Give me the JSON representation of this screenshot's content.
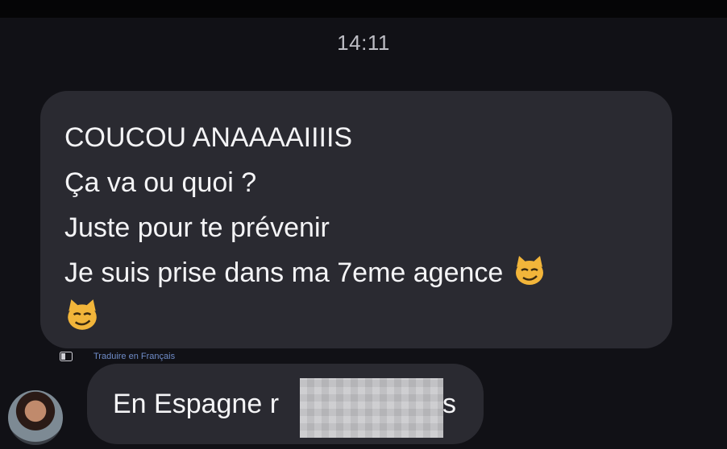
{
  "conversation": {
    "timestamp": "14:11",
    "message1": {
      "lines": [
        "COUCOU ANAAAAIIIIS",
        "Ça va ou quoi ?",
        "Juste pour te prévenir",
        "Je suis prise dans ma 7eme agence"
      ],
      "emoji": "smirking-cat-emoji"
    },
    "translate_label": "Traduire en Français",
    "message2": {
      "text_visible_start": "En Espagne r",
      "text_visible_end": "s"
    }
  },
  "colors": {
    "background": "#111116",
    "bubble": "#2a2a31",
    "text": "#f4f4f6",
    "timestamp": "#bdbdc4",
    "translate_link": "#6f8cc8"
  }
}
